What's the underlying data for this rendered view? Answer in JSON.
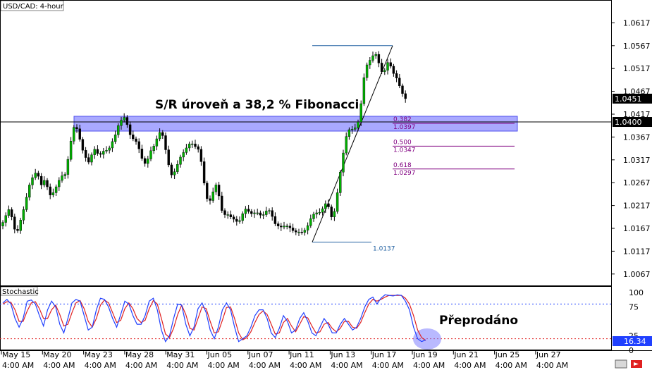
{
  "chart_title": "USD/CAD: 4-hour",
  "price_axis": {
    "ticks": [
      "1.0617",
      "1.0567",
      "1.0517",
      "1.0467",
      "1.0417",
      "1.0367",
      "1.0317",
      "1.0267",
      "1.0217",
      "1.0167",
      "1.0117",
      "1.0067"
    ],
    "current_price": "1.0451",
    "level_label": "1.0400"
  },
  "annotations": {
    "sr_label": "S/R úroveň a 38,2 % Fibonacci",
    "oversold_label": "Přeprodáno"
  },
  "fibonacci": {
    "swing_high": 1.0567,
    "swing_low": 1.0137,
    "swing_low_label": "1.0137",
    "levels": [
      {
        "ratio": "0.382",
        "price": "1.0397"
      },
      {
        "ratio": "0.500",
        "price": "1.0347"
      },
      {
        "ratio": "0.618",
        "price": "1.0297"
      }
    ]
  },
  "stochastic": {
    "title": "Stochastic",
    "ticks": [
      "100",
      "75",
      "25",
      "0"
    ],
    "current_value": "16.34",
    "upper_level": 80,
    "lower_level": 20
  },
  "x_axis": {
    "labels": [
      [
        "May 15",
        "4:00 AM"
      ],
      [
        "May 20",
        "4:00 AM"
      ],
      [
        "May 23",
        "4:00 AM"
      ],
      [
        "May 28",
        "4:00 AM"
      ],
      [
        "May 31",
        "4:00 AM"
      ],
      [
        "Jun 05",
        "4:00 AM"
      ],
      [
        "Jun 07",
        "4:00 AM"
      ],
      [
        "Jun 11",
        "4:00 AM"
      ],
      [
        "Jun 13",
        "4:00 AM"
      ],
      [
        "Jun 17",
        "4:00 AM"
      ],
      [
        "Jun 19",
        "4:00 AM"
      ],
      [
        "Jun 21",
        "4:00 AM"
      ],
      [
        "Jun 25",
        "4:00 AM"
      ],
      [
        "Jun 27",
        "4:00 AM"
      ]
    ]
  },
  "colors": {
    "bull": "#00b000",
    "bear": "#000000",
    "sr_zone": "#7070ff",
    "fib_high_line": "#1f5fa0",
    "fib_line": "#800080",
    "stoch_k": "#2040ff",
    "stoch_d": "#e02020",
    "oversold_marker": "#8080ff"
  },
  "chart_data": {
    "type": "candlestick",
    "title": "USD/CAD: 4-hour",
    "ylim": [
      1.0042,
      1.0667
    ],
    "close_prices": [
      1.018,
      1.0195,
      1.0208,
      1.0192,
      1.0165,
      1.0162,
      1.0185,
      1.0208,
      1.0235,
      1.0262,
      1.0278,
      1.0288,
      1.0281,
      1.0262,
      1.0272,
      1.0258,
      1.024,
      1.0245,
      1.0258,
      1.0272,
      1.0282,
      1.0285,
      1.0318,
      1.0358,
      1.0388,
      1.0385,
      1.0362,
      1.0338,
      1.0322,
      1.0312,
      1.0328,
      1.034,
      1.0331,
      1.0329,
      1.0336,
      1.0338,
      1.0343,
      1.0357,
      1.0372,
      1.0392,
      1.0404,
      1.041,
      1.0394,
      1.0372,
      1.0363,
      1.0357,
      1.0341,
      1.032,
      1.0309,
      1.0319,
      1.0337,
      1.0347,
      1.0363,
      1.0377,
      1.037,
      1.0339,
      1.0306,
      1.0284,
      1.0291,
      1.0307,
      1.0323,
      1.0333,
      1.0343,
      1.0352,
      1.0352,
      1.0346,
      1.034,
      1.0313,
      1.0266,
      1.0232,
      1.0228,
      1.0247,
      1.0262,
      1.0238,
      1.0206,
      1.0197,
      1.0197,
      1.0192,
      1.0187,
      1.0182,
      1.0184,
      1.0199,
      1.0209,
      1.0204,
      1.0199,
      1.0201,
      1.0201,
      1.0196,
      1.0197,
      1.0205,
      1.0206,
      1.0193,
      1.0177,
      1.0172,
      1.017,
      1.0172,
      1.0172,
      1.0168,
      1.0162,
      1.0159,
      1.0159,
      1.0158,
      1.0163,
      1.0173,
      1.0188,
      1.0198,
      1.0201,
      1.0202,
      1.021,
      1.0221,
      1.0214,
      1.0192,
      1.0204,
      1.0245,
      1.029,
      1.0332,
      1.0368,
      1.0383,
      1.0384,
      1.0387,
      1.04,
      1.044,
      1.0497,
      1.0525,
      1.0535,
      1.0545,
      1.0548,
      1.0529,
      1.051,
      1.0513,
      1.053,
      1.0522,
      1.0506,
      1.0496,
      1.0479,
      1.0462,
      1.0451
    ],
    "stochastic_k": [
      82,
      88,
      80,
      55,
      40,
      55,
      85,
      87,
      80,
      60,
      42,
      70,
      85,
      75,
      45,
      30,
      55,
      82,
      88,
      85,
      60,
      35,
      40,
      70,
      90,
      88,
      75,
      55,
      40,
      62,
      85,
      80,
      60,
      45,
      45,
      60,
      85,
      90,
      70,
      35,
      15,
      25,
      55,
      80,
      78,
      45,
      25,
      40,
      72,
      82,
      65,
      35,
      20,
      40,
      70,
      82,
      70,
      40,
      15,
      20,
      25,
      40,
      60,
      70,
      70,
      55,
      30,
      22,
      38,
      60,
      50,
      30,
      35,
      55,
      65,
      50,
      30,
      25,
      40,
      55,
      45,
      30,
      30,
      45,
      55,
      45,
      35,
      40,
      55,
      75,
      88,
      92,
      80,
      90,
      96,
      95,
      94,
      96,
      95,
      85,
      70,
      40,
      20,
      15,
      18
    ],
    "stochastic_d": [
      80,
      84,
      83,
      70,
      50,
      50,
      68,
      82,
      84,
      72,
      55,
      55,
      70,
      78,
      62,
      42,
      45,
      65,
      82,
      86,
      72,
      50,
      40,
      55,
      78,
      87,
      82,
      65,
      48,
      52,
      72,
      82,
      72,
      55,
      48,
      52,
      72,
      86,
      80,
      55,
      28,
      22,
      38,
      62,
      78,
      62,
      38,
      35,
      55,
      75,
      72,
      50,
      30,
      32,
      52,
      74,
      75,
      55,
      30,
      18,
      22,
      32,
      48,
      62,
      68,
      62,
      45,
      28,
      30,
      48,
      55,
      42,
      32,
      45,
      58,
      56,
      42,
      30,
      32,
      45,
      48,
      38,
      32,
      38,
      50,
      50,
      40,
      38,
      48,
      65,
      80,
      88,
      85,
      88,
      92,
      95,
      95,
      95,
      95,
      90,
      80,
      60,
      35,
      22,
      17
    ]
  }
}
